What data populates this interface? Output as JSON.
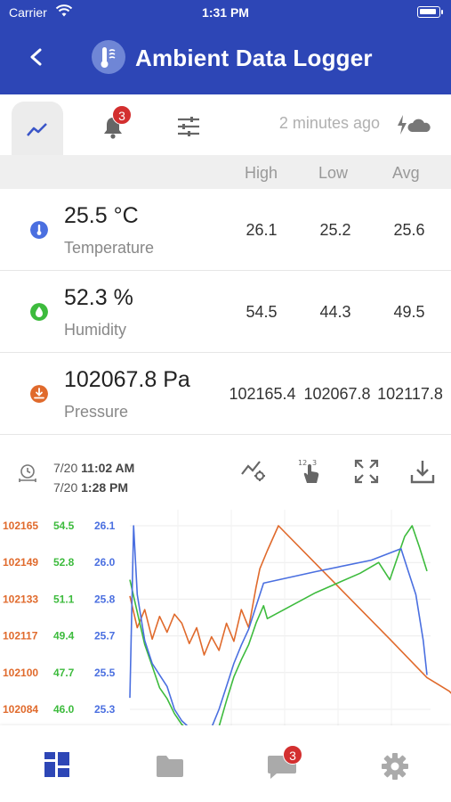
{
  "status": {
    "carrier": "Carrier",
    "time": "1:31 PM"
  },
  "header": {
    "title": "Ambient Data Logger"
  },
  "toolbar": {
    "alerts_count": "3",
    "updated": "2 minutes ago"
  },
  "table": {
    "headers": [
      "High",
      "Low",
      "Avg"
    ],
    "rows": [
      {
        "value": "25.5 °C",
        "label": "Temperature",
        "high": "26.1",
        "low": "25.2",
        "avg": "25.6",
        "color": "#4a6fe0"
      },
      {
        "value": "52.3 %",
        "label": "Humidity",
        "high": "54.5",
        "low": "44.3",
        "avg": "49.5",
        "color": "#3dbb3d"
      },
      {
        "value": "102067.8 Pa",
        "label": "Pressure",
        "high": "102165.4",
        "low": "102067.8",
        "avg": "102117.8",
        "color": "#e06a2c"
      }
    ]
  },
  "range": {
    "start_date": "7/20",
    "start_time": "11:02 AM",
    "end_date": "7/20",
    "end_time": "1:28 PM"
  },
  "colors": {
    "brand": "#2d46b6",
    "temperature": "#4a6fe0",
    "humidity": "#3dbb3d",
    "pressure": "#e06a2c",
    "badge": "#d32f2f"
  },
  "chart_data": {
    "type": "line",
    "axes": {
      "pressure": [
        "102165",
        "102149",
        "102133",
        "102117",
        "102100",
        "102084"
      ],
      "humidity": [
        "54.5",
        "52.8",
        "51.1",
        "49.4",
        "47.7",
        "46.0"
      ],
      "temperature": [
        "26.1",
        "26.0",
        "25.8",
        "25.7",
        "25.5",
        "25.3"
      ]
    },
    "series": [
      {
        "name": "Pressure",
        "color": "#e06a2c",
        "points": [
          [
            0,
            102134
          ],
          [
            0.02,
            102120
          ],
          [
            0.04,
            102128
          ],
          [
            0.06,
            102115
          ],
          [
            0.08,
            102125
          ],
          [
            0.1,
            102118
          ],
          [
            0.12,
            102126
          ],
          [
            0.14,
            102122
          ],
          [
            0.16,
            102113
          ],
          [
            0.18,
            102120
          ],
          [
            0.2,
            102108
          ],
          [
            0.22,
            102116
          ],
          [
            0.24,
            102110
          ],
          [
            0.26,
            102122
          ],
          [
            0.28,
            102114
          ],
          [
            0.3,
            102128
          ],
          [
            0.32,
            102120
          ],
          [
            0.34,
            102138
          ],
          [
            0.35,
            102146
          ],
          [
            0.37,
            102154
          ],
          [
            0.4,
            102165
          ],
          [
            0.55,
            102140
          ],
          [
            0.7,
            102115
          ],
          [
            0.8,
            102098
          ],
          [
            0.86,
            102092
          ],
          [
            0.9,
            102085
          ],
          [
            0.92,
            102078
          ]
        ]
      },
      {
        "name": "Humidity",
        "color": "#3dbb3d",
        "points": [
          [
            0,
            52.0
          ],
          [
            0.02,
            50.5
          ],
          [
            0.04,
            49.0
          ],
          [
            0.06,
            48.0
          ],
          [
            0.08,
            47.0
          ],
          [
            0.1,
            46.5
          ],
          [
            0.12,
            45.8
          ],
          [
            0.14,
            45.3
          ],
          [
            0.16,
            45.0
          ],
          [
            0.18,
            44.6
          ],
          [
            0.2,
            44.3
          ],
          [
            0.22,
            44.5
          ],
          [
            0.24,
            45.2
          ],
          [
            0.26,
            46.4
          ],
          [
            0.28,
            47.5
          ],
          [
            0.3,
            48.3
          ],
          [
            0.32,
            49.0
          ],
          [
            0.34,
            50.0
          ],
          [
            0.36,
            50.8
          ],
          [
            0.37,
            50.2
          ],
          [
            0.5,
            51.4
          ],
          [
            0.62,
            52.3
          ],
          [
            0.67,
            52.8
          ],
          [
            0.7,
            52.0
          ],
          [
            0.74,
            54.0
          ],
          [
            0.76,
            54.5
          ],
          [
            0.78,
            53.5
          ],
          [
            0.8,
            52.4
          ]
        ]
      },
      {
        "name": "Temperature",
        "color": "#4a6fe0",
        "points": [
          [
            0,
            25.35
          ],
          [
            0.01,
            26.1
          ],
          [
            0.02,
            25.8
          ],
          [
            0.04,
            25.6
          ],
          [
            0.06,
            25.5
          ],
          [
            0.08,
            25.45
          ],
          [
            0.1,
            25.4
          ],
          [
            0.12,
            25.3
          ],
          [
            0.14,
            25.25
          ],
          [
            0.16,
            25.22
          ],
          [
            0.18,
            25.2
          ],
          [
            0.2,
            25.18
          ],
          [
            0.22,
            25.22
          ],
          [
            0.24,
            25.3
          ],
          [
            0.26,
            25.4
          ],
          [
            0.28,
            25.5
          ],
          [
            0.3,
            25.58
          ],
          [
            0.32,
            25.65
          ],
          [
            0.34,
            25.75
          ],
          [
            0.36,
            25.85
          ],
          [
            0.5,
            25.9
          ],
          [
            0.65,
            25.95
          ],
          [
            0.73,
            26.0
          ],
          [
            0.75,
            25.9
          ],
          [
            0.77,
            25.8
          ],
          [
            0.79,
            25.6
          ],
          [
            0.8,
            25.45
          ]
        ]
      }
    ]
  }
}
